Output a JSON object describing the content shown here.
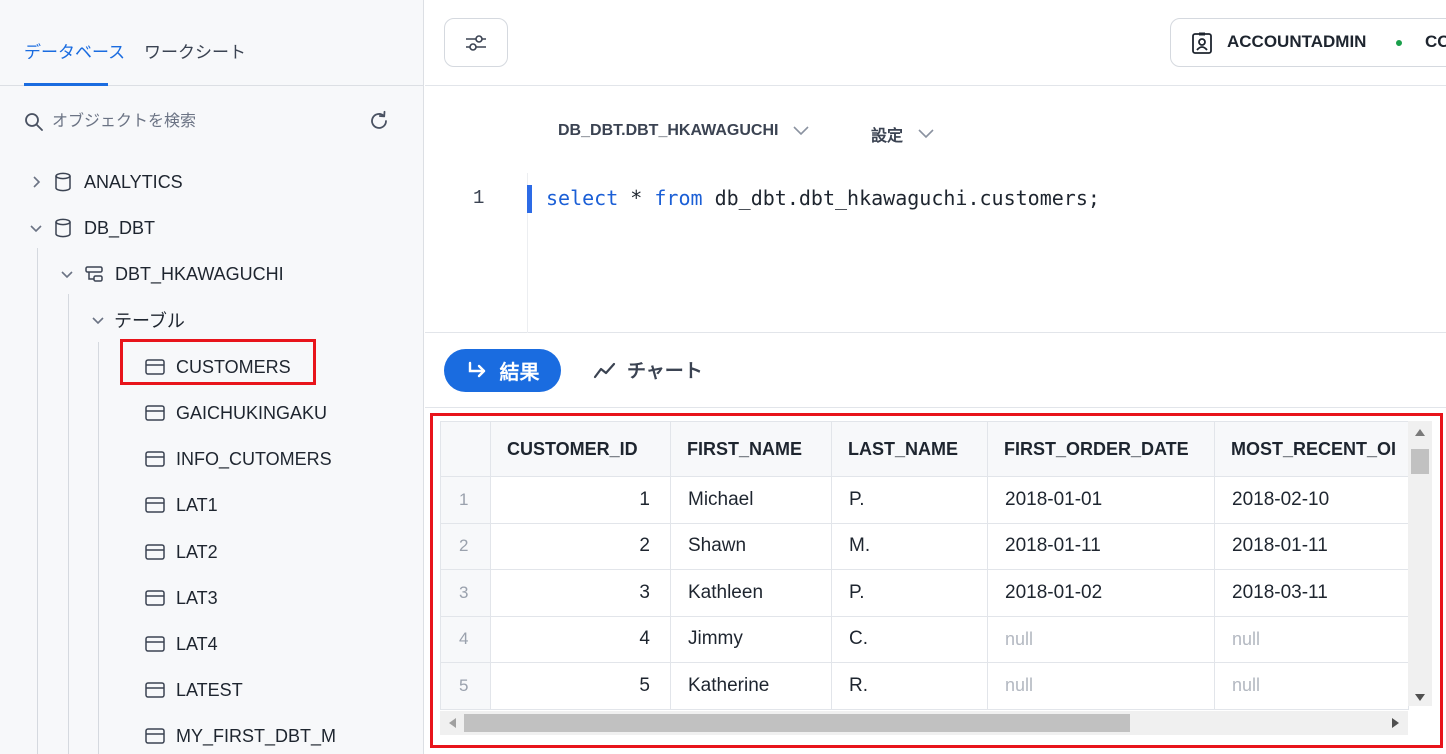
{
  "sidebar": {
    "tabs": [
      {
        "label": "データベース"
      },
      {
        "label": "ワークシート"
      }
    ],
    "search_placeholder": "オブジェクトを検索",
    "tree": {
      "analytics": "ANALYTICS",
      "db_dbt": "DB_DBT",
      "schema": "DBT_HKAWAGUCHI",
      "tables_folder": "テーブル",
      "tables": [
        "CUSTOMERS",
        "GAICHUKINGAKU",
        "INFO_CUTOMERS",
        "LAT1",
        "LAT2",
        "LAT3",
        "LAT4",
        "LATEST",
        "MY_FIRST_DBT_M"
      ]
    }
  },
  "topbar": {
    "role": "ACCOUNTADMIN",
    "warehouse": "CO"
  },
  "editor": {
    "context": "DB_DBT.DBT_HKAWAGUCHI",
    "settings_label": "設定",
    "line_number": "1",
    "code": {
      "select": "select",
      "star": " * ",
      "from": "from",
      "rest": " db_dbt.dbt_hkawaguchi.customers;"
    }
  },
  "results_bar": {
    "results_label": "結果",
    "chart_label": "チャート"
  },
  "grid": {
    "columns": [
      "CUSTOMER_ID",
      "FIRST_NAME",
      "LAST_NAME",
      "FIRST_ORDER_DATE",
      "MOST_RECENT_OI"
    ],
    "rows": [
      {
        "n": "1",
        "id": "1",
        "first": "Michael",
        "last": "P.",
        "first_order": "2018-01-01",
        "recent": "2018-02-10"
      },
      {
        "n": "2",
        "id": "2",
        "first": "Shawn",
        "last": "M.",
        "first_order": "2018-01-11",
        "recent": "2018-01-11"
      },
      {
        "n": "3",
        "id": "3",
        "first": "Kathleen",
        "last": "P.",
        "first_order": "2018-01-02",
        "recent": "2018-03-11"
      },
      {
        "n": "4",
        "id": "4",
        "first": "Jimmy",
        "last": "C.",
        "first_order": "null",
        "recent": "null"
      },
      {
        "n": "5",
        "id": "5",
        "first": "Katherine",
        "last": "R.",
        "first_order": "null",
        "recent": "null"
      }
    ]
  },
  "colors": {
    "accent": "#1a6ce0",
    "highlight": "#e8141b",
    "keyword": "#1b5fd6"
  }
}
